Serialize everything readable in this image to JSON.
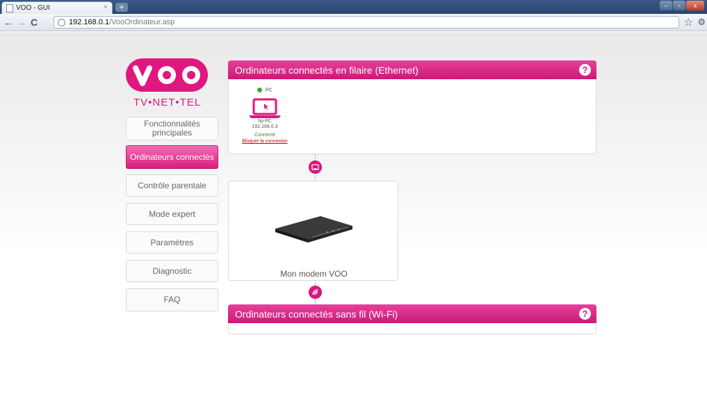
{
  "browser": {
    "tab_title": "VOO - GUI",
    "tab_close": "×",
    "new_tab": "+",
    "url_host": "192.168.0.1",
    "url_path": "/VooOrdinateur.asp"
  },
  "brand": {
    "logo_text": "VOO",
    "tagline": "TV•NET•TEL",
    "accent": "#d91f7f"
  },
  "menu": [
    {
      "label": "Fonctionnalités principales",
      "active": false
    },
    {
      "label": "Ordinateurs connectés",
      "active": true
    },
    {
      "label": "Contrôle parentale",
      "active": false
    },
    {
      "label": "Mode expert",
      "active": false
    },
    {
      "label": "Paramètres",
      "active": false
    },
    {
      "label": "Diagnostic",
      "active": false
    },
    {
      "label": "FAQ",
      "active": false
    }
  ],
  "ethernet": {
    "title": "Ordinateurs connectés en filaire (Ethernet)",
    "help": "?",
    "device": {
      "type_label": "PC",
      "name": "hp-PC",
      "ip": "192.168.0.3",
      "status": "Connecté",
      "block_link": "Bloquer la connexion"
    }
  },
  "modem": {
    "caption": "Mon modem VOO"
  },
  "wifi": {
    "title": "Ordinateurs connectés sans fil (Wi-Fi)",
    "help": "?"
  }
}
